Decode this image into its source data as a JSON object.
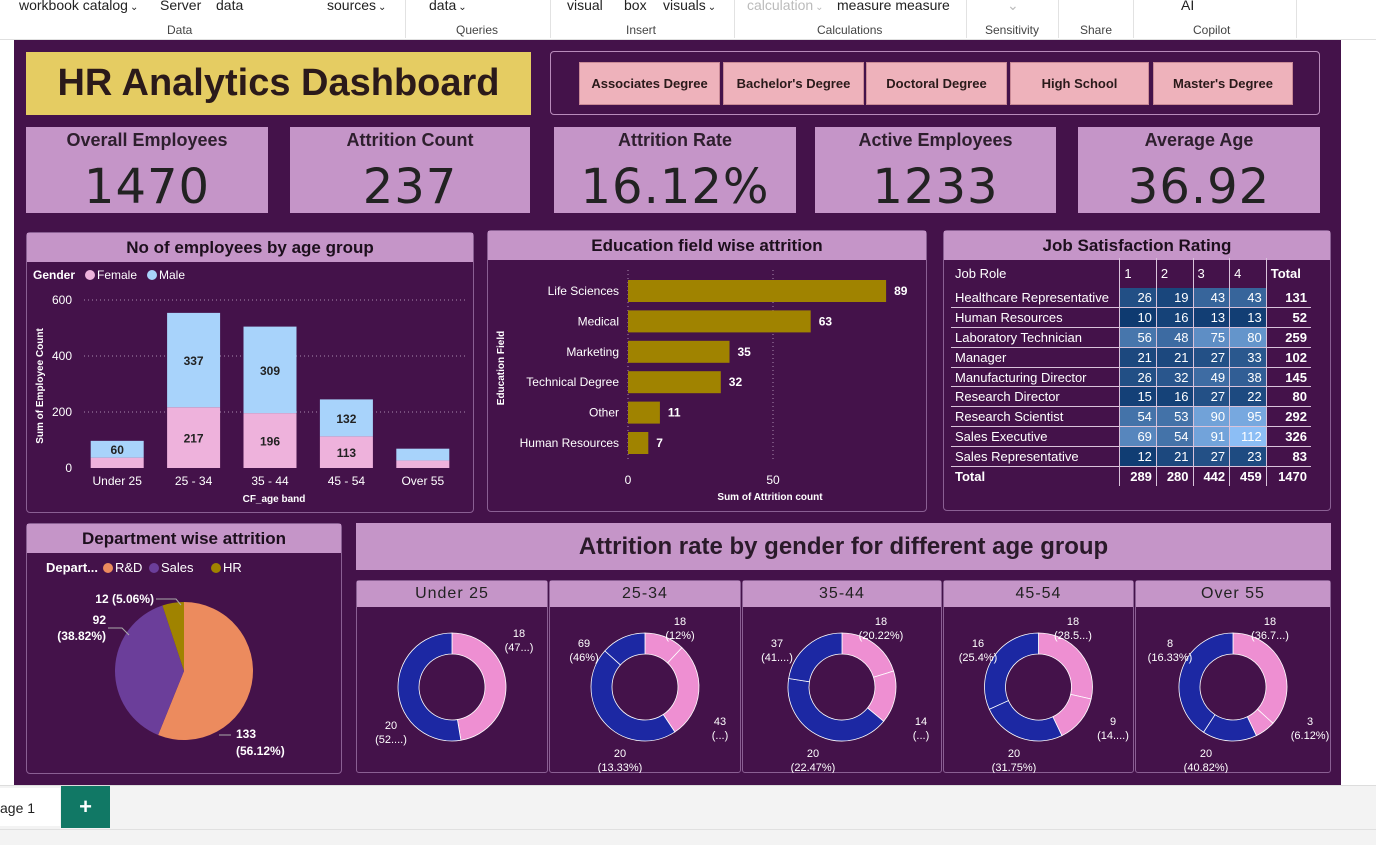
{
  "ribbon": {
    "items": [
      {
        "label": "workbook catalog",
        "chev": true
      },
      {
        "label": "Server",
        "chev": false
      },
      {
        "label": "data",
        "chev": false
      },
      {
        "label": "sources",
        "chev": true
      },
      {
        "label": "data",
        "chev": true
      },
      {
        "label": "visual",
        "chev": false
      },
      {
        "label": "box",
        "chev": false
      },
      {
        "label": "visuals",
        "chev": true
      },
      {
        "label": "calculation",
        "chev": true
      },
      {
        "label": "measure measure",
        "chev": false
      },
      {
        "label": "AI",
        "chev": false
      }
    ],
    "groups": [
      "Data",
      "Queries",
      "Insert",
      "Calculations",
      "Sensitivity",
      "Share",
      "Copilot"
    ]
  },
  "dashboard": {
    "title": "HR Analytics Dashboard",
    "education_slicer": [
      "Associates Degree",
      "Bachelor's Degree",
      "Doctoral Degree",
      "High School",
      "Master's Degree"
    ],
    "kpis": [
      {
        "label": "Overall Employees",
        "value": "1470"
      },
      {
        "label": "Attrition Count",
        "value": "237"
      },
      {
        "label": "Attrition Rate",
        "value": "16.12%"
      },
      {
        "label": "Active Employees",
        "value": "1233"
      },
      {
        "label": "Average Age",
        "value": "36.92"
      }
    ],
    "job_satisfaction": {
      "title": "Job Satisfaction Rating",
      "headers": [
        "Job Role",
        "1",
        "2",
        "3",
        "4",
        "Total"
      ],
      "rows": [
        {
          "role": "Healthcare Representative",
          "v": [
            26,
            19,
            43,
            43
          ],
          "total": 131
        },
        {
          "role": "Human Resources",
          "v": [
            10,
            16,
            13,
            13
          ],
          "total": 52
        },
        {
          "role": "Laboratory Technician",
          "v": [
            56,
            48,
            75,
            80
          ],
          "total": 259
        },
        {
          "role": "Manager",
          "v": [
            21,
            21,
            27,
            33
          ],
          "total": 102
        },
        {
          "role": "Manufacturing Director",
          "v": [
            26,
            32,
            49,
            38
          ],
          "total": 145
        },
        {
          "role": "Research Director",
          "v": [
            15,
            16,
            27,
            22
          ],
          "total": 80
        },
        {
          "role": "Research Scientist",
          "v": [
            54,
            53,
            90,
            95
          ],
          "total": 292
        },
        {
          "role": "Sales Executive",
          "v": [
            69,
            54,
            91,
            112
          ],
          "total": 326
        },
        {
          "role": "Sales Representative",
          "v": [
            12,
            21,
            27,
            23
          ],
          "total": 83
        }
      ],
      "total_row": {
        "role": "Total",
        "v": [
          289,
          280,
          442,
          459
        ],
        "total": 1470
      }
    },
    "gender_banner": "Attrition rate by gender for different age group"
  },
  "chart_data": [
    {
      "id": "age",
      "type": "bar",
      "title": "No of employees by age group",
      "legend_title": "Gender",
      "categories": [
        "Under 25",
        "25 - 34",
        "35 - 44",
        "45 - 54",
        "Over 55"
      ],
      "series": [
        {
          "name": "Female",
          "color": "#eeb2dc",
          "values": [
            37,
            217,
            196,
            113,
            27
          ]
        },
        {
          "name": "Male",
          "color": "#a8d3fb",
          "values": [
            60,
            337,
            309,
            132,
            42
          ]
        }
      ],
      "labels": {
        "Female": [
          "",
          "217",
          "196",
          "113",
          ""
        ],
        "Male": [
          "60",
          "337",
          "309",
          "132",
          ""
        ]
      },
      "xlabel": "CF_age band",
      "ylabel": "Sum of Employee Count",
      "yticks": [
        0,
        200,
        400,
        600
      ],
      "ylim": [
        0,
        600
      ]
    },
    {
      "id": "edu",
      "type": "bar",
      "title": "Education field wise attrition",
      "orientation": "horizontal",
      "categories": [
        "Life Sciences",
        "Medical",
        "Marketing",
        "Technical Degree",
        "Other",
        "Human Resources"
      ],
      "values": [
        89,
        63,
        35,
        32,
        11,
        7
      ],
      "color": "#a08300",
      "xlabel": "Sum of Attrition count",
      "ylabel": "Education Field",
      "xticks": [
        0,
        50
      ],
      "xlim": [
        0,
        100
      ]
    },
    {
      "id": "dept",
      "type": "pie",
      "title": "Department wise attrition",
      "legend_title": "Depart...",
      "slices": [
        {
          "name": "R&D",
          "value": 133,
          "label1": "133",
          "label2": "(56.12%)",
          "color": "#ec8b5e"
        },
        {
          "name": "Sales",
          "value": 92,
          "label1": "92",
          "label2": "(38.82%)",
          "color": "#6b3e9a"
        },
        {
          "name": "HR",
          "value": 12,
          "label1": "12 (5.06%)",
          "label2": "",
          "color": "#a08300"
        }
      ]
    },
    {
      "id": "donuts",
      "type": "pie",
      "style": "donut",
      "colors": {
        "female": "#ee8fd2",
        "male": "#1c28a3"
      },
      "groups": [
        {
          "title": "Under 25",
          "segments": [
            {
              "value": 18,
              "color": "female",
              "l1": "18",
              "l2": "(47...)",
              "side": "right"
            },
            {
              "value": 20,
              "color": "male",
              "l1": "20",
              "l2": "(52....)",
              "side": "left"
            }
          ]
        },
        {
          "title": "25-34",
          "segments": [
            {
              "value": 18,
              "color": "female",
              "l1": "18",
              "l2": "(12%)",
              "side": "right"
            },
            {
              "value": 43,
              "color": "female",
              "l1": "43",
              "l2": "(...)",
              "side": "right"
            },
            {
              "value": 20,
              "color": "male",
              "l1": "20",
              "l2": "(13.33%)",
              "side": "left"
            },
            {
              "value": 69,
              "color": "male",
              "l1": "69",
              "l2": "(46%)",
              "side": "left"
            }
          ]
        },
        {
          "title": "35-44",
          "segments": [
            {
              "value": 18,
              "color": "female",
              "l1": "18",
              "l2": "(20.22%)",
              "side": "right"
            },
            {
              "value": 14,
              "color": "female",
              "l1": "14",
              "l2": "(...)",
              "side": "right"
            },
            {
              "value": 20,
              "color": "male",
              "l1": "20",
              "l2": "(22.47%)",
              "side": "left"
            },
            {
              "value": 37,
              "color": "male",
              "l1": "37",
              "l2": "(41....)",
              "side": "left"
            }
          ]
        },
        {
          "title": "45-54",
          "segments": [
            {
              "value": 18,
              "color": "female",
              "l1": "18",
              "l2": "(28.5...)",
              "side": "right"
            },
            {
              "value": 9,
              "color": "female",
              "l1": "9",
              "l2": "(14....)",
              "side": "right"
            },
            {
              "value": 20,
              "color": "male",
              "l1": "20",
              "l2": "(31.75%)",
              "side": "left"
            },
            {
              "value": 16,
              "color": "male",
              "l1": "16",
              "l2": "(25.4%)",
              "side": "left"
            }
          ]
        },
        {
          "title": "Over 55",
          "segments": [
            {
              "value": 18,
              "color": "female",
              "l1": "18",
              "l2": "(36.7...)",
              "side": "right"
            },
            {
              "value": 3,
              "color": "female",
              "l1": "3",
              "l2": "(6.12%)",
              "side": "right"
            },
            {
              "value": 20,
              "color": "male",
              "l1": "20",
              "l2": "(40.82%)",
              "side": "left"
            },
            {
              "value": 8,
              "color": "male",
              "l1": "8",
              "l2": "(16.33%)",
              "side": "left"
            }
          ]
        }
      ]
    }
  ],
  "footer": {
    "page_tab": "age 1",
    "add_tab": "+"
  }
}
